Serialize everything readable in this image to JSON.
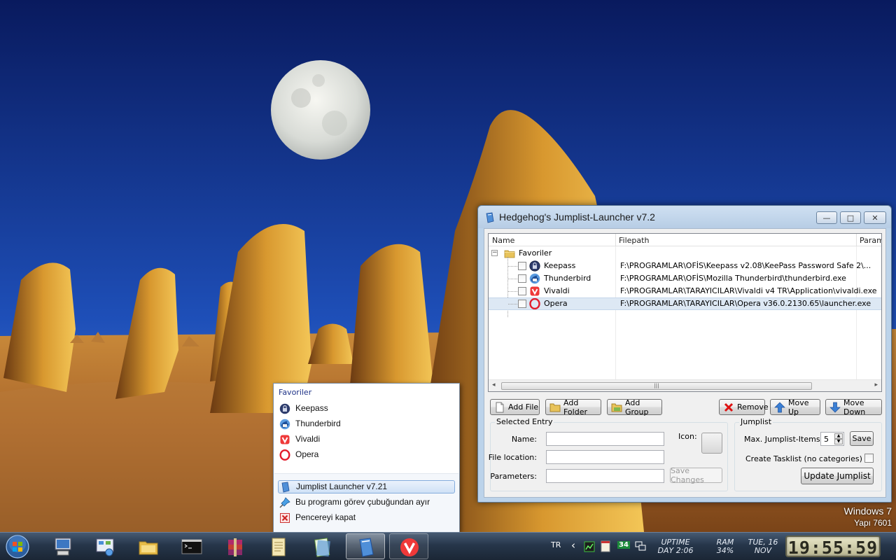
{
  "desktop": {
    "os_name": "Windows 7",
    "build": "Yapı 7601"
  },
  "window": {
    "title": "Hedgehog's Jumplist-Launcher v7.2",
    "controls": {
      "minimize": "—",
      "maximize": "□",
      "close": "✕"
    },
    "tree": {
      "columns": [
        "Name",
        "Filepath",
        "Param"
      ],
      "group": {
        "name": "Favoriler",
        "expander": "−"
      },
      "items": [
        {
          "name": "Keepass",
          "path": "F:\\PROGRAMLAR\\OFİS\\Keepass v2.08\\KeePass Password Safe 2\\...",
          "icon": "keepass-lock-icon",
          "selected": false
        },
        {
          "name": "Thunderbird",
          "path": "F:\\PROGRAMLAR\\OFİS\\Mozilla Thunderbird\\thunderbird.exe",
          "icon": "thunderbird-icon",
          "selected": false
        },
        {
          "name": "Vivaldi",
          "path": "F:\\PROGRAMLAR\\TARAYICILAR\\Vivaldi v4 TR\\Application\\vivaldi.exe",
          "icon": "vivaldi-icon",
          "selected": false
        },
        {
          "name": "Opera",
          "path": "F:\\PROGRAMLAR\\TARAYICILAR\\Opera v36.0.2130.65\\launcher.exe",
          "icon": "opera-icon",
          "selected": true
        }
      ],
      "scroll_grip": "|||",
      "scroll_left": "◂",
      "scroll_right": "▸"
    },
    "toolbar": {
      "add_file": "Add File",
      "add_folder": "Add Folder",
      "add_group": "Add Group",
      "remove": "Remove",
      "move_up": "Move Up",
      "move_down": "Move Down"
    },
    "selected_entry": {
      "group_label": "Selected Entry",
      "name_label": "Name:",
      "name_value": "",
      "file_location_label": "File location:",
      "file_location_value": "",
      "parameters_label": "Parameters:",
      "parameters_value": "",
      "icon_label": "Icon:",
      "save_changes": "Save Changes"
    },
    "jumplist": {
      "group_label": "Jumplist",
      "max_items_label": "Max. Jumplist-Items",
      "max_items_value": "5",
      "save": "Save",
      "create_tasklist_label": "Create Tasklist (no categories)",
      "create_tasklist_checked": false,
      "update": "Update Jumplist"
    }
  },
  "jumplist_menu": {
    "category": "Favoriler",
    "items": [
      {
        "label": "Keepass",
        "icon": "keepass-lock-icon"
      },
      {
        "label": "Thunderbird",
        "icon": "thunderbird-icon"
      },
      {
        "label": "Vivaldi",
        "icon": "vivaldi-icon"
      },
      {
        "label": "Opera",
        "icon": "opera-icon"
      }
    ],
    "tasks": [
      {
        "label": "Jumplist Launcher v7.21",
        "icon": "jumplist-launcher-icon",
        "highlighted": true
      },
      {
        "label": "Bu programı görev çubuğundan ayır",
        "icon": "unpin-icon",
        "highlighted": false
      },
      {
        "label": "Pencereyi kapat",
        "icon": "close-window-icon",
        "highlighted": false
      }
    ]
  },
  "taskbar": {
    "apps": [
      {
        "name": "computer",
        "state": "normal"
      },
      {
        "name": "control-panel",
        "state": "normal"
      },
      {
        "name": "explorer",
        "state": "normal"
      },
      {
        "name": "cmd",
        "state": "normal"
      },
      {
        "name": "winrar",
        "state": "normal"
      },
      {
        "name": "notepad",
        "state": "normal"
      },
      {
        "name": "notepad-plus",
        "state": "normal"
      },
      {
        "name": "jumplist-launcher",
        "state": "active"
      },
      {
        "name": "vivaldi",
        "state": "running"
      }
    ],
    "language": "TR",
    "tray_expand": "‹",
    "tray_badge": "34",
    "uptime_label": "UPTIME",
    "uptime_value": "DAY 2:06",
    "ram_label": "RAM",
    "ram_value": "34%",
    "date_line1": "TUE, 16",
    "date_line2": "NOV",
    "clock": "19:55:59"
  },
  "colors": {
    "sky_top": "#0b1f6e",
    "sky_bottom": "#3a6fd0",
    "selection": "#dde8f4",
    "jumplist_category": "#1e3287"
  }
}
